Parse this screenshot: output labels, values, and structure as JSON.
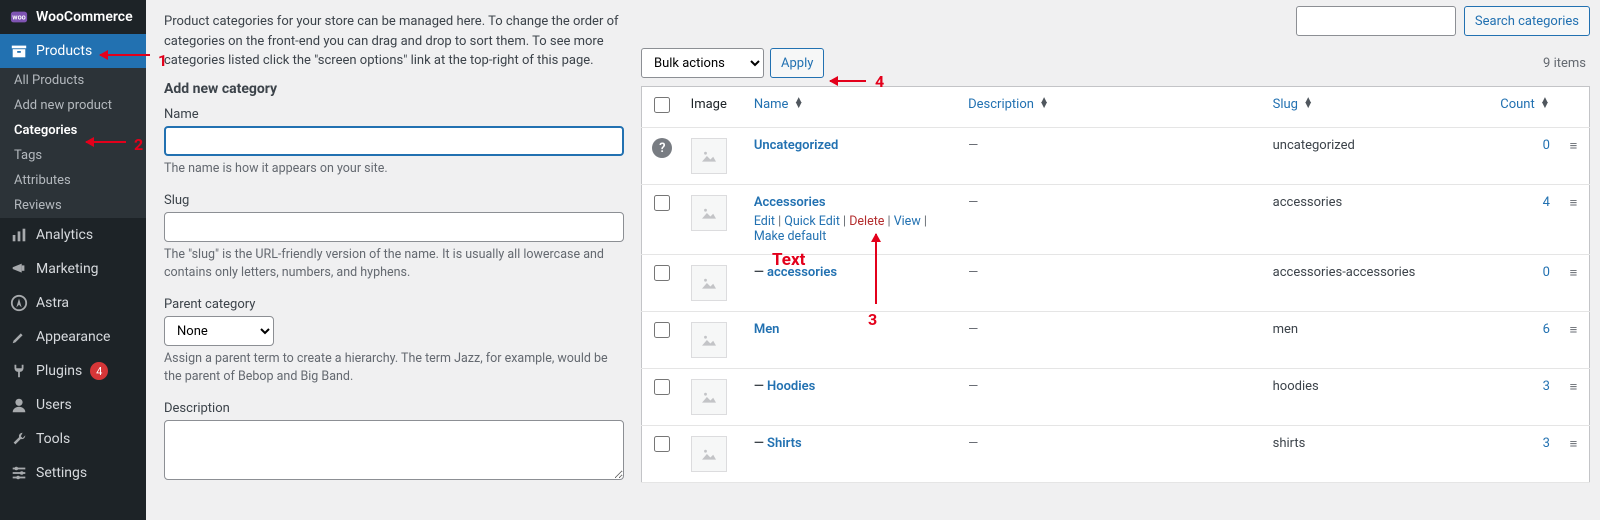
{
  "sidebar": {
    "woocommerce": "WooCommerce",
    "products": "Products",
    "subitems": [
      "All Products",
      "Add new product",
      "Categories",
      "Tags",
      "Attributes",
      "Reviews"
    ],
    "analytics": "Analytics",
    "marketing": "Marketing",
    "astra": "Astra",
    "appearance": "Appearance",
    "plugins": "Plugins",
    "plugins_badge": "4",
    "users": "Users",
    "tools": "Tools",
    "settings": "Settings"
  },
  "intro": "Product categories for your store can be managed here. To change the order of categories on the front-end you can drag and drop to sort them. To see more categories listed click the \"screen options\" link at the top-right of this page.",
  "form": {
    "title": "Add new category",
    "name_label": "Name",
    "name_hint": "The name is how it appears on your site.",
    "slug_label": "Slug",
    "slug_hint": "The \"slug\" is the URL-friendly version of the name. It is usually all lowercase and contains only letters, numbers, and hyphens.",
    "parent_label": "Parent category",
    "parent_value": "None",
    "parent_hint": "Assign a parent term to create a hierarchy. The term Jazz, for example, would be the parent of Bebop and Big Band.",
    "desc_label": "Description"
  },
  "search": {
    "button": "Search categories"
  },
  "bulk": {
    "select": "Bulk actions",
    "apply": "Apply",
    "count": "9 items"
  },
  "columns": {
    "image": "Image",
    "name": "Name",
    "description": "Description",
    "slug": "Slug",
    "count": "Count"
  },
  "rows": [
    {
      "name": "Uncategorized",
      "desc": "—",
      "slug": "uncategorized",
      "count": "0",
      "indent": "",
      "question": true
    },
    {
      "name": "Accessories",
      "desc": "—",
      "slug": "accessories",
      "count": "4",
      "indent": "",
      "actions": true
    },
    {
      "name": "accessories",
      "desc": "—",
      "slug": "accessories-accessories",
      "count": "0",
      "indent": "— "
    },
    {
      "name": "Men",
      "desc": "—",
      "slug": "men",
      "count": "6",
      "indent": ""
    },
    {
      "name": "Hoodies",
      "desc": "—",
      "slug": "hoodies",
      "count": "3",
      "indent": "— "
    },
    {
      "name": "Shirts",
      "desc": "—",
      "slug": "shirts",
      "count": "3",
      "indent": "— "
    }
  ],
  "row_actions": {
    "edit": "Edit",
    "quick": "Quick Edit",
    "delete": "Delete",
    "view": "View",
    "make_default": "Make default"
  },
  "anno": {
    "one": "1",
    "two": "2",
    "three": "3",
    "four": "4",
    "text": "Text"
  }
}
